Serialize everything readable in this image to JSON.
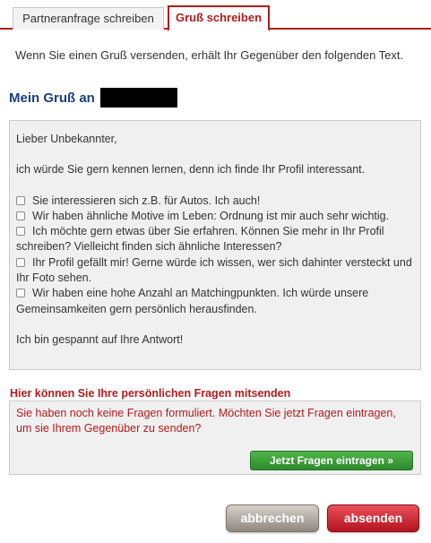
{
  "tabs": [
    {
      "label": "Partneranfrage schreiben",
      "active": false
    },
    {
      "label": "Gruß schreiben",
      "active": true
    }
  ],
  "intro": "Wenn Sie einen Gruß versenden, erhält Ihr Gegenüber den folgenden Text.",
  "greeting_heading": "Mein Gruß an",
  "message": {
    "salutation": "Lieber Unbekannter,",
    "body": "ich würde Sie gern kennen lernen, denn ich finde Ihr Profil interessant.",
    "options": [
      {
        "label": "Sie interessieren sich z.B. für Autos. Ich auch!",
        "checked": false
      },
      {
        "label": "Wir haben ähnliche Motive im Leben: Ordnung ist mir auch sehr wichtig.",
        "checked": false
      },
      {
        "label": "Ich möchte gern etwas über Sie erfahren. Können Sie mehr in Ihr Profil schreiben? Vielleicht finden sich ähnliche Interessen?",
        "checked": false
      },
      {
        "label": "Ihr Profil gefällt mir! Gerne würde ich wissen, wer sich dahinter versteckt und Ihr Foto sehen.",
        "checked": false
      },
      {
        "label": "Wir haben eine hohe Anzahl an Matchingpunkten. Ich würde unsere Gemeinsamkeiten gern persönlich herausfinden.",
        "checked": false
      }
    ],
    "closing": "Ich bin gespannt auf Ihre Antwort!"
  },
  "questions": {
    "label": "Hier können Sie Ihre persönlichen Fragen mitsenden",
    "empty_text": "Sie haben noch keine Fragen formuliert. Möchten Sie jetzt Fragen eintragen, um sie Ihrem Gegenüber zu senden?",
    "button_label": "Jetzt Fragen eintragen »"
  },
  "actions": {
    "cancel_label": "abbrechen",
    "send_label": "absenden"
  },
  "colors": {
    "accent_red": "#b01c1c",
    "heading_blue": "#1c3f7c",
    "green_button": "#3a9d36"
  }
}
